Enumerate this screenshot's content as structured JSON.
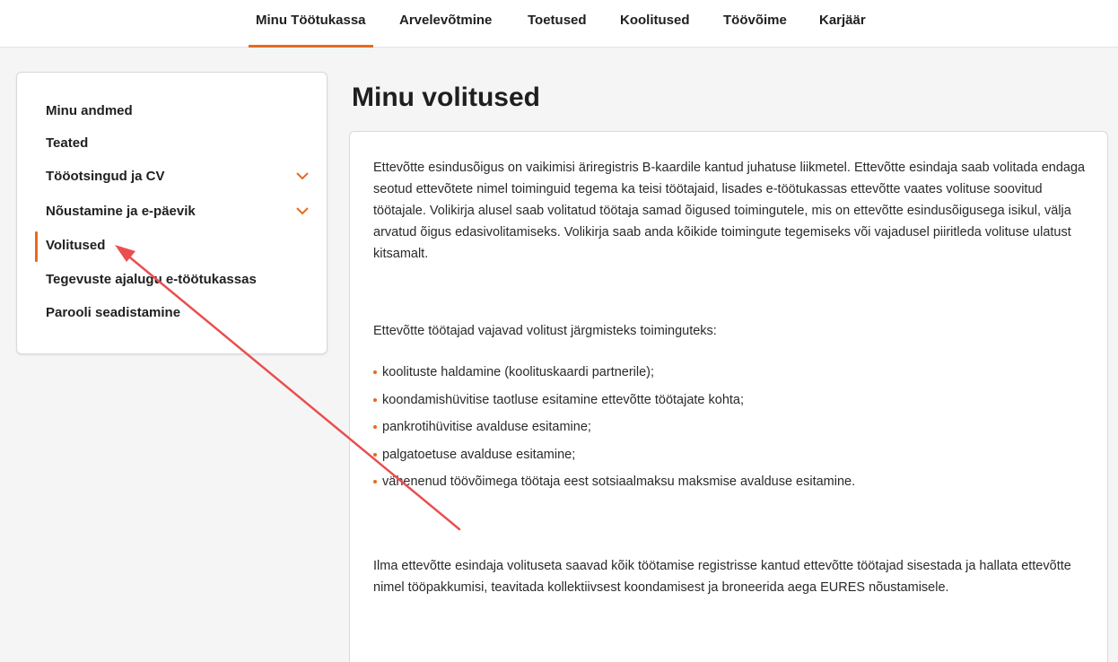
{
  "topnav": {
    "tabs": [
      {
        "label": "Minu Töötukassa",
        "active": true
      },
      {
        "label": "Arvelevõtmine",
        "active": false
      },
      {
        "label": "Toetused",
        "active": false
      },
      {
        "label": "Koolitused",
        "active": false
      },
      {
        "label": "Töövõime",
        "active": false
      },
      {
        "label": "Karjäär",
        "active": false
      }
    ]
  },
  "sidebar": {
    "items": [
      {
        "label": "Minu andmed",
        "expandable": false
      },
      {
        "label": "Teated",
        "expandable": false
      },
      {
        "label": "Tööotsingud ja CV",
        "expandable": true
      },
      {
        "label": "Nõustamine ja e-päevik",
        "expandable": true
      },
      {
        "label": "Volitused",
        "expandable": false,
        "active": true
      },
      {
        "label": "Tegevuste ajalugu e-töötukassas",
        "expandable": false
      },
      {
        "label": "Parooli seadistamine",
        "expandable": false
      }
    ]
  },
  "main": {
    "title": "Minu volitused",
    "paragraph1": "Ettevõtte esindusõigus on vaikimisi äriregistris B-kaardile kantud juhatuse liikmetel. Ettevõtte esindaja saab volitada endaga seotud ettevõtete nimel toiminguid tegema ka teisi töötajaid, lisades e-töötukassas ettevõtte vaates volituse soovitud töötajale. Volikirja alusel saab volitatud töötaja samad õigused toimingutele, mis on ettevõtte esindusõigusega isikul, välja arvatud õigus edasivolitamiseks. Volikirja saab anda kõikide toimingute tegemiseks või vajadusel piiritleda volituse ulatust kitsamalt.",
    "paragraph2": "Ettevõtte töötajad vajavad volitust järgmisteks toiminguteks:",
    "bullets": [
      "koolituste haldamine (koolituskaardi partnerile);",
      "koondamishüvitise taotluse esitamine ettevõtte töötajate kohta;",
      "pankrotihüvitise avalduse esitamine;",
      "palgatoetuse avalduse esitamine;",
      "vähenenud töövõimega töötaja eest sotsiaalmaksu maksmise avalduse esitamine."
    ],
    "paragraph3": "Ilma ettevõtte esindaja volituseta saavad kõik töötamise registrisse kantud ettevõtte töötajad sisestada ja hallata ettevõtte nimel tööpakkumisi, teavitada kollektiivsest koondamisest ja broneerida aega EURES nõustamisele."
  },
  "colors": {
    "accent": "#e86a1c",
    "annotation_arrow": "#e8504f"
  }
}
